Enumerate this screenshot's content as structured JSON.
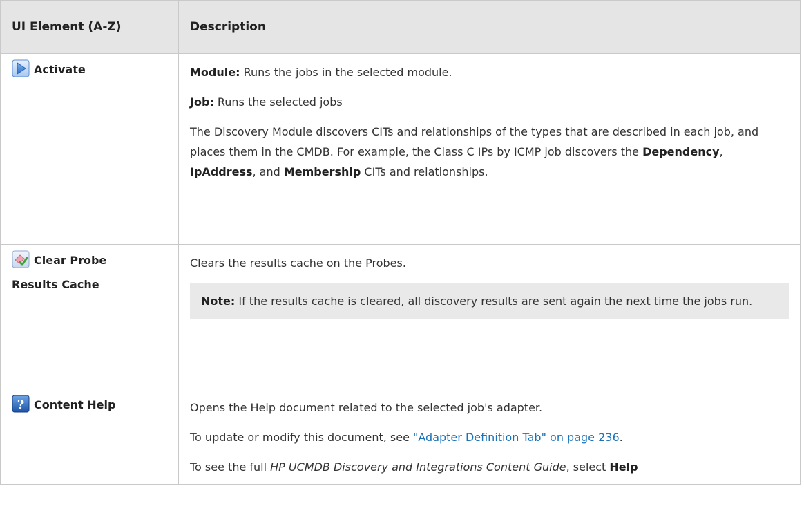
{
  "table": {
    "headers": {
      "element": "UI Element (A-Z)",
      "description": "Description"
    },
    "activate": {
      "name": "Activate",
      "icon": "play-arrow-icon",
      "module_label": "Module:",
      "module_text": " Runs the jobs in the selected module.",
      "job_label": "Job:",
      "job_text": " Runs the selected jobs",
      "para_a": "The Discovery Module discovers CITs and relationships of the types that are described in each job, and places them in the CMDB. For example, the Class C IPs by ICMP job discovers the ",
      "term1": "Dependency",
      "sep1": ", ",
      "term2": "IpAddress",
      "sep2": ", and ",
      "term3": "Membership",
      "para_b": " CITs and relationships."
    },
    "clear_cache": {
      "name_line1": "Clear Probe",
      "name_line2": "Results Cache",
      "icon": "eraser-check-icon",
      "desc": "Clears the results cache on the Probes.",
      "note_label": "Note:",
      "note_text": " If the results cache is cleared, all discovery results are sent again the next time the jobs run."
    },
    "content_help": {
      "name": "Content Help",
      "icon": "question-mark-icon",
      "desc": "Opens the Help document related to the selected job's adapter.",
      "update_pre": "To update or modify this document, see ",
      "update_link": "\"Adapter Definition Tab\" on page 236",
      "update_post": ".",
      "guide_pre": "To see the full ",
      "guide_title": "HP UCMDB Discovery and Integrations Content Guide",
      "guide_mid": ", select ",
      "guide_help": "Help"
    }
  }
}
